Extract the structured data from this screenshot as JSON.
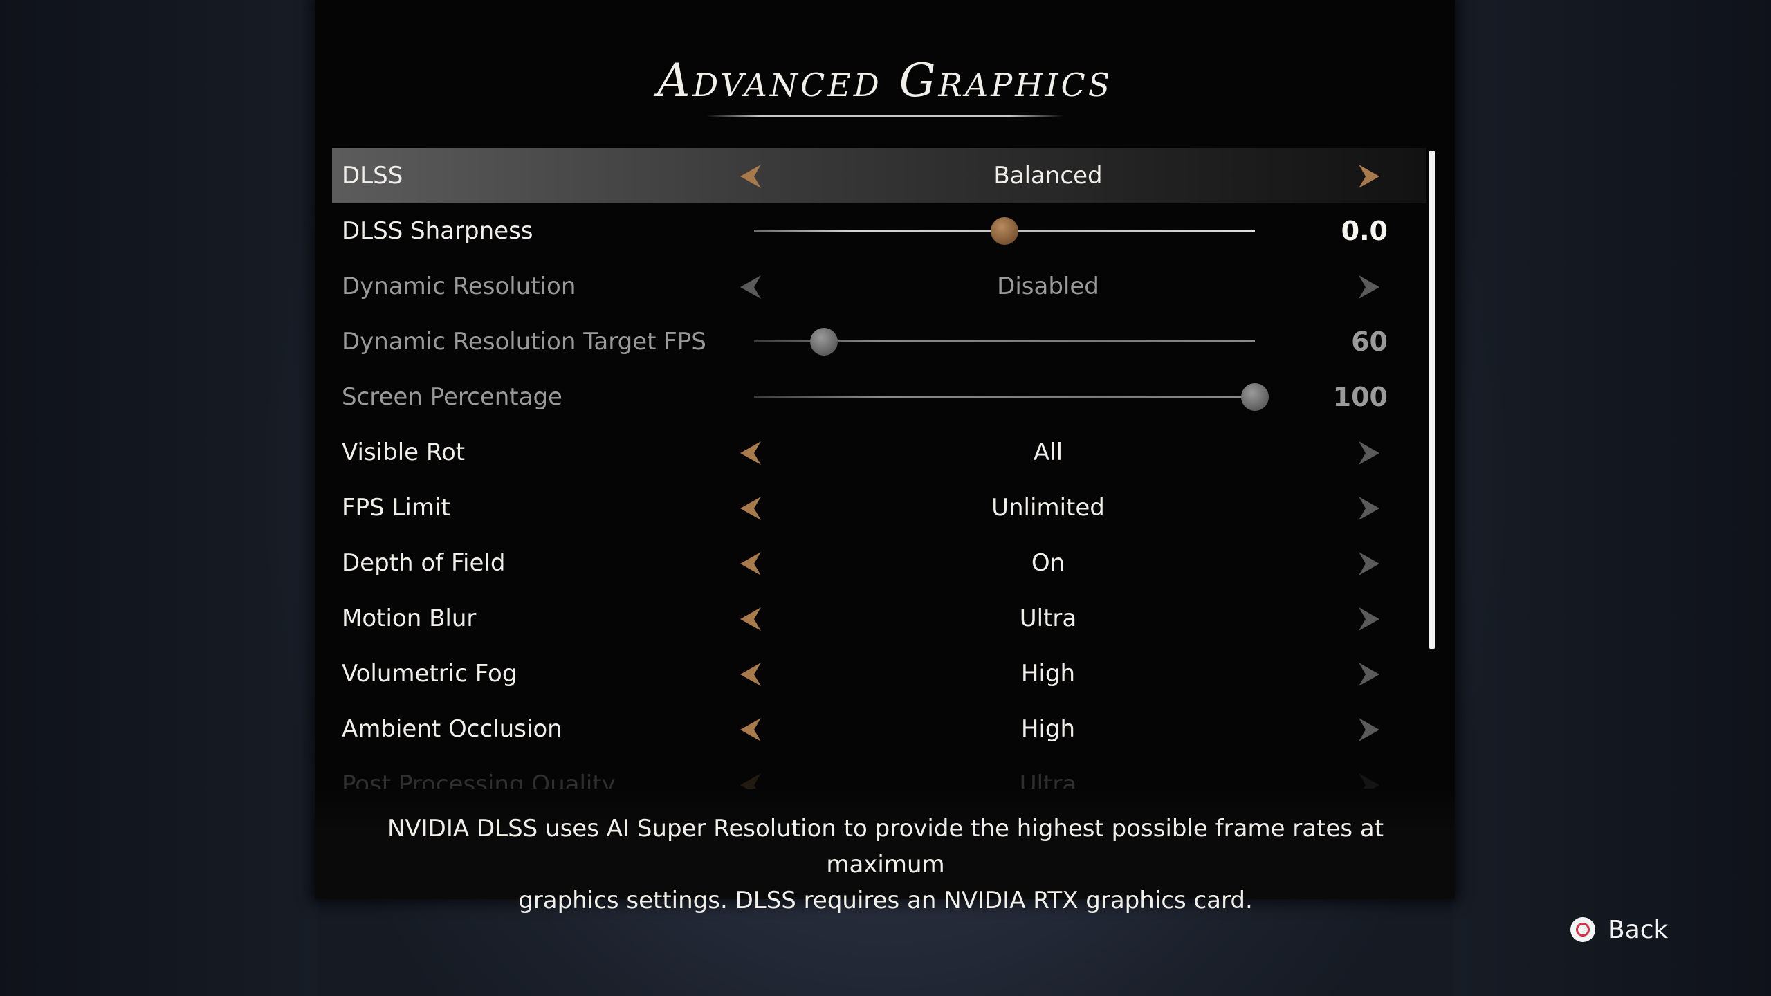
{
  "header": {
    "title": "Advanced Graphics"
  },
  "settings": [
    {
      "label": "DLSS",
      "type": "selector",
      "value": "Balanced",
      "selected": true,
      "disabled": false
    },
    {
      "label": "DLSS Sharpness",
      "type": "slider",
      "value": "0.0",
      "level": 0.5,
      "selected": false,
      "disabled": false
    },
    {
      "label": "Dynamic Resolution",
      "type": "selector",
      "value": "Disabled",
      "selected": false,
      "disabled": true
    },
    {
      "label": "Dynamic Resolution Target FPS",
      "type": "slider",
      "value": "60",
      "level": 0.14,
      "selected": false,
      "disabled": true
    },
    {
      "label": "Screen Percentage",
      "type": "slider",
      "value": "100",
      "level": 1.0,
      "selected": false,
      "disabled": true
    },
    {
      "label": "Visible Rot",
      "type": "selector",
      "value": "All",
      "selected": false,
      "disabled": false
    },
    {
      "label": "FPS Limit",
      "type": "selector",
      "value": "Unlimited",
      "selected": false,
      "disabled": false
    },
    {
      "label": "Depth of Field",
      "type": "selector",
      "value": "On",
      "selected": false,
      "disabled": false
    },
    {
      "label": "Motion Blur",
      "type": "selector",
      "value": "Ultra",
      "selected": false,
      "disabled": false
    },
    {
      "label": "Volumetric Fog",
      "type": "selector",
      "value": "High",
      "selected": false,
      "disabled": false
    },
    {
      "label": "Ambient Occlusion",
      "type": "selector",
      "value": "High",
      "selected": false,
      "disabled": false
    },
    {
      "label": "Post Processing Quality",
      "type": "selector",
      "value": "Ultra",
      "selected": false,
      "disabled": false,
      "faded": true
    }
  ],
  "description": {
    "line1": "NVIDIA DLSS uses AI Super Resolution to provide the highest possible frame rates at maximum",
    "line2": "graphics settings. DLSS requires an NVIDIA RTX graphics card."
  },
  "footer": {
    "back_label": "Back",
    "back_icon": "circle-button-icon"
  },
  "colors": {
    "accent_arrow": "#a8794a",
    "inactive_arrow": "#5a5a5a",
    "text": "#f0efea",
    "disabled_text": "#9a9a9a",
    "panel": "#050505"
  }
}
